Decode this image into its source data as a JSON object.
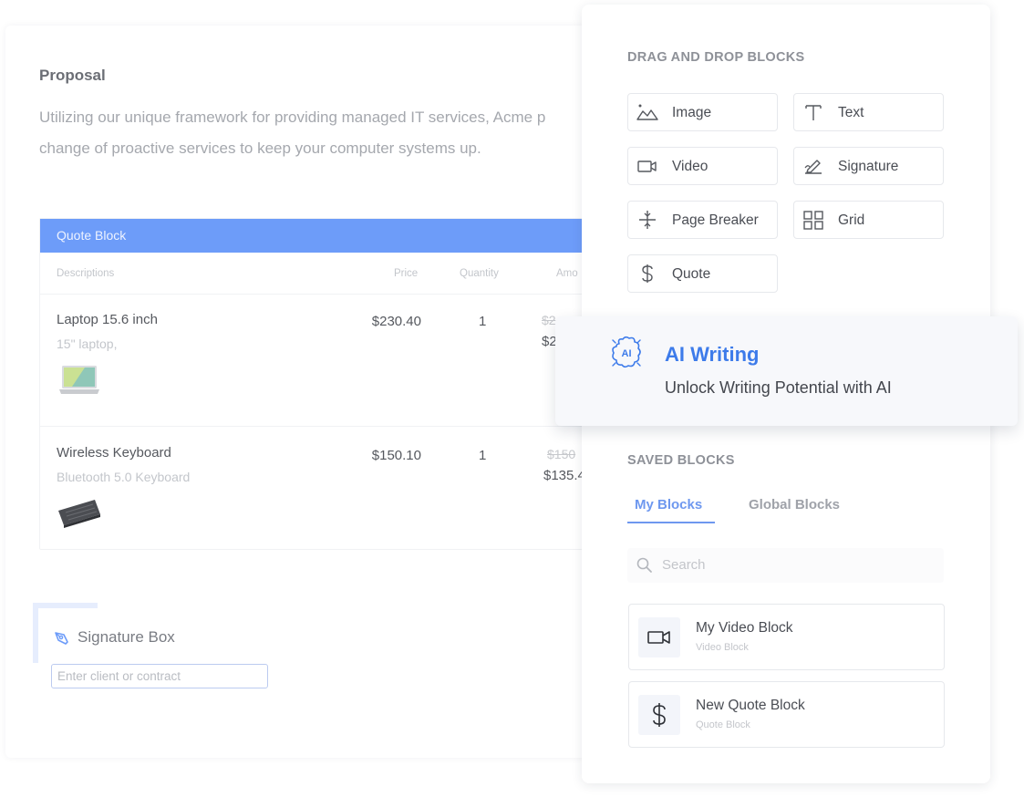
{
  "document": {
    "title": "Proposal",
    "body_line1": "Utilizing our unique framework for providing managed IT services, Acme  p",
    "body_line2": "change of proactive services to keep your computer systems up.",
    "quote_block": {
      "header": "Quote Block",
      "columns": {
        "description": "Descriptions",
        "price": "Price",
        "quantity": "Quantity",
        "amount": "Amo"
      },
      "rows": [
        {
          "name": "Laptop 15.6 inch",
          "subtitle": "15\" laptop,",
          "price": "$230.40",
          "quantity": "1",
          "old_amount": "$2",
          "amount": "$2"
        },
        {
          "name": "Wireless Keyboard",
          "subtitle": "Bluetooth 5.0 Keyboard",
          "price": "$150.10",
          "quantity": "1",
          "old_amount": "$150",
          "amount": "$135.4"
        }
      ]
    },
    "signature_box": {
      "label": "Signature Box",
      "placeholder": "Enter client or contract"
    }
  },
  "panel": {
    "drag_drop_title": "DRAG AND DROP BLOCKS",
    "blocks": [
      {
        "label": "Image",
        "icon": "image-icon"
      },
      {
        "label": "Text",
        "icon": "text-icon"
      },
      {
        "label": "Video",
        "icon": "video-icon"
      },
      {
        "label": "Signature",
        "icon": "signature-icon"
      },
      {
        "label": "Page Breaker",
        "icon": "page-breaker-icon"
      },
      {
        "label": "Grid",
        "icon": "grid-icon"
      },
      {
        "label": "Quote",
        "icon": "dollar-icon"
      }
    ],
    "ai_card": {
      "title": "AI Writing",
      "subtitle": "Unlock Writing Potential with AI",
      "icon": "ai-brain-icon"
    },
    "saved_title": "SAVED BLOCKS",
    "tabs": {
      "my_blocks": "My Blocks",
      "global_blocks": "Global Blocks",
      "active": "My Blocks"
    },
    "search_placeholder": "Search",
    "saved_blocks": [
      {
        "title": "My Video Block",
        "type": "Video Block",
        "icon": "video-icon"
      },
      {
        "title": "New Quote Block",
        "type": "Quote Block",
        "icon": "dollar-icon"
      }
    ]
  },
  "colors": {
    "accent": "#3d7bea",
    "quote_header": "#6d9cf9",
    "tab_active": "#6e98ef"
  }
}
